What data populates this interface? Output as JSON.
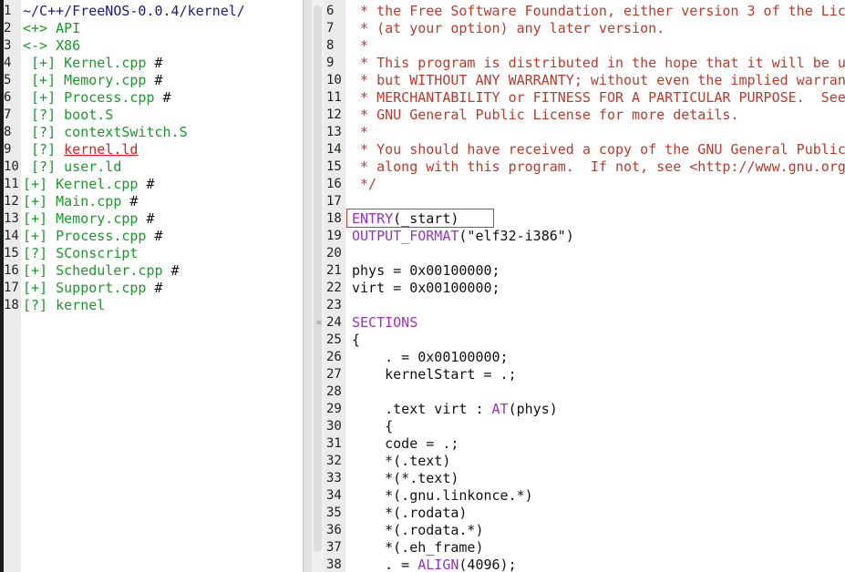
{
  "left_pane": {
    "lines": [
      {
        "num": "1",
        "segments": [
          {
            "t": "~/C++/FreeNOS-0.0.4/kernel/",
            "c": "dir"
          }
        ]
      },
      {
        "num": "2",
        "segments": [
          {
            "t": "<+> API",
            "c": "green"
          }
        ]
      },
      {
        "num": "3",
        "segments": [
          {
            "t": "<-> X86",
            "c": "green"
          }
        ]
      },
      {
        "num": "4",
        "segments": [
          {
            "t": " [+] Kernel.cpp ",
            "c": "green"
          },
          {
            "t": "#",
            "c": "plain"
          }
        ]
      },
      {
        "num": "5",
        "segments": [
          {
            "t": " [+] Memory.cpp ",
            "c": "green"
          },
          {
            "t": "#",
            "c": "plain"
          }
        ]
      },
      {
        "num": "6",
        "segments": [
          {
            "t": " [+] Process.cpp ",
            "c": "green"
          },
          {
            "t": "#",
            "c": "plain"
          }
        ]
      },
      {
        "num": "7",
        "segments": [
          {
            "t": " [?] boot.S",
            "c": "green"
          }
        ]
      },
      {
        "num": "8",
        "segments": [
          {
            "t": " [?] contextSwitch.S",
            "c": "green"
          }
        ]
      },
      {
        "num": "9",
        "segments": [
          {
            "t": " [?] ",
            "c": "green"
          },
          {
            "t": "kernel.ld",
            "c": "red-ul"
          }
        ]
      },
      {
        "num": "10",
        "segments": [
          {
            "t": " [?] user.ld",
            "c": "green"
          }
        ]
      },
      {
        "num": "11",
        "segments": [
          {
            "t": "[+] Kernel.cpp ",
            "c": "green"
          },
          {
            "t": "#",
            "c": "plain"
          }
        ]
      },
      {
        "num": "12",
        "segments": [
          {
            "t": "[+] Main.cpp ",
            "c": "green"
          },
          {
            "t": "#",
            "c": "plain"
          }
        ]
      },
      {
        "num": "13",
        "segments": [
          {
            "t": "[+] Memory.cpp ",
            "c": "green"
          },
          {
            "t": "#",
            "c": "plain"
          }
        ]
      },
      {
        "num": "14",
        "segments": [
          {
            "t": "[+] Process.cpp ",
            "c": "green"
          },
          {
            "t": "#",
            "c": "plain"
          }
        ]
      },
      {
        "num": "15",
        "segments": [
          {
            "t": "[?] SConscript",
            "c": "green"
          }
        ]
      },
      {
        "num": "16",
        "segments": [
          {
            "t": "[+] Scheduler.cpp ",
            "c": "green"
          },
          {
            "t": "#",
            "c": "plain"
          }
        ]
      },
      {
        "num": "17",
        "segments": [
          {
            "t": "[+] Support.cpp ",
            "c": "green"
          },
          {
            "t": "#",
            "c": "plain"
          }
        ]
      },
      {
        "num": "18",
        "segments": [
          {
            "t": "[?] kernel",
            "c": "green"
          }
        ]
      }
    ]
  },
  "right_pane": {
    "lines": [
      {
        "num": "6",
        "segments": [
          {
            "t": " * the Free Software Foundation, either version 3 of the Lic",
            "c": "cmt"
          }
        ]
      },
      {
        "num": "7",
        "segments": [
          {
            "t": " * (at your option) any later version.",
            "c": "cmt"
          }
        ]
      },
      {
        "num": "8",
        "segments": [
          {
            "t": " *",
            "c": "cmt"
          }
        ]
      },
      {
        "num": "9",
        "segments": [
          {
            "t": " * This program is distributed in the hope that it will be u",
            "c": "cmt"
          }
        ]
      },
      {
        "num": "10",
        "segments": [
          {
            "t": " * but WITHOUT ANY WARRANTY; without even the implied warran",
            "c": "cmt"
          }
        ]
      },
      {
        "num": "11",
        "segments": [
          {
            "t": " * MERCHANTABILITY or FITNESS FOR A PARTICULAR PURPOSE.  See",
            "c": "cmt"
          }
        ]
      },
      {
        "num": "12",
        "segments": [
          {
            "t": " * GNU General Public License for more details.",
            "c": "cmt"
          }
        ]
      },
      {
        "num": "13",
        "segments": [
          {
            "t": " *",
            "c": "cmt"
          }
        ]
      },
      {
        "num": "14",
        "segments": [
          {
            "t": " * You should have received a copy of the GNU General Public",
            "c": "cmt"
          }
        ]
      },
      {
        "num": "15",
        "segments": [
          {
            "t": " * along with this program.  If not, see <http://www.gnu.org",
            "c": "cmt"
          }
        ]
      },
      {
        "num": "16",
        "segments": [
          {
            "t": " */",
            "c": "cmt"
          }
        ]
      },
      {
        "num": "17",
        "segments": []
      },
      {
        "num": "18",
        "segments": [
          {
            "t": "ENTRY",
            "c": "kw"
          },
          {
            "t": "(_start)",
            "c": "plain"
          }
        ]
      },
      {
        "num": "19",
        "segments": [
          {
            "t": "OUTPUT_FORMAT",
            "c": "kw"
          },
          {
            "t": "(\"elf32-i386\")",
            "c": "plain"
          }
        ]
      },
      {
        "num": "20",
        "segments": []
      },
      {
        "num": "21",
        "segments": [
          {
            "t": "phys = 0x00100000;",
            "c": "plain"
          }
        ]
      },
      {
        "num": "22",
        "segments": [
          {
            "t": "virt = 0x00100000;",
            "c": "plain"
          }
        ]
      },
      {
        "num": "23",
        "segments": []
      },
      {
        "num": "24",
        "segments": [
          {
            "t": "SECTIONS",
            "c": "kw"
          }
        ]
      },
      {
        "num": "25",
        "segments": [
          {
            "t": "{",
            "c": "plain"
          }
        ]
      },
      {
        "num": "26",
        "segments": [
          {
            "t": "    . = 0x00100000;",
            "c": "plain"
          }
        ]
      },
      {
        "num": "27",
        "segments": [
          {
            "t": "    kernelStart = .;",
            "c": "plain"
          }
        ]
      },
      {
        "num": "28",
        "segments": []
      },
      {
        "num": "29",
        "segments": [
          {
            "t": "    .text virt : ",
            "c": "plain"
          },
          {
            "t": "AT",
            "c": "kw"
          },
          {
            "t": "(phys)",
            "c": "plain"
          }
        ]
      },
      {
        "num": "30",
        "segments": [
          {
            "t": "    {",
            "c": "plain"
          }
        ]
      },
      {
        "num": "31",
        "segments": [
          {
            "t": "    code = .;",
            "c": "plain"
          }
        ]
      },
      {
        "num": "32",
        "segments": [
          {
            "t": "    *(.text)",
            "c": "plain"
          }
        ]
      },
      {
        "num": "33",
        "segments": [
          {
            "t": "    *(*.text)",
            "c": "plain"
          }
        ]
      },
      {
        "num": "34",
        "segments": [
          {
            "t": "    *(.gnu.linkonce.*)",
            "c": "plain"
          }
        ]
      },
      {
        "num": "35",
        "segments": [
          {
            "t": "    *(.rodata)",
            "c": "plain"
          }
        ]
      },
      {
        "num": "36",
        "segments": [
          {
            "t": "    *(.rodata.*)",
            "c": "plain"
          }
        ]
      },
      {
        "num": "37",
        "segments": [
          {
            "t": "    *(.eh_frame)",
            "c": "plain"
          }
        ]
      },
      {
        "num": "38",
        "segments": [
          {
            "t": "    . = ",
            "c": "plain"
          },
          {
            "t": "ALIGN",
            "c": "kw"
          },
          {
            "t": "(4096);",
            "c": "plain"
          }
        ]
      }
    ],
    "fold_marker": "="
  },
  "colors": {
    "comment": "#c0392b",
    "keyword": "#9b30c8",
    "tree_item": "#1a9a2a",
    "path": "#1a1a8a",
    "highlight_box": "#e03030",
    "selected_file": "#e02020"
  }
}
